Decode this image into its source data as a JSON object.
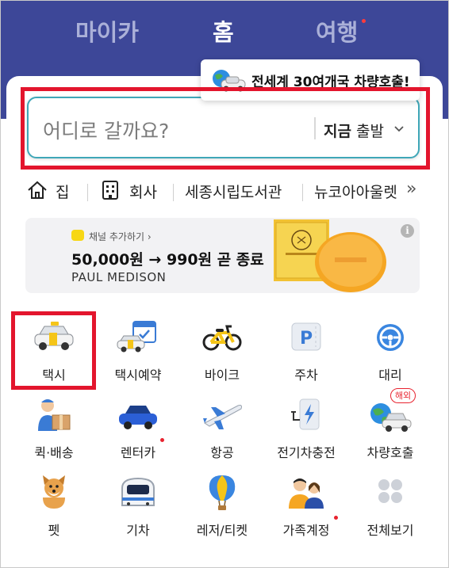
{
  "top_tabs": [
    {
      "label": "마이카",
      "active": false
    },
    {
      "label": "홈",
      "active": true
    },
    {
      "label": "여행",
      "active": false,
      "has_dot": true
    }
  ],
  "tooltip": {
    "text": "전세계 30여개국 차량호출!"
  },
  "search": {
    "placeholder": "어디로 갈까요?",
    "depart_now": "지금",
    "depart_label": "출발"
  },
  "places": [
    {
      "label": "집",
      "icon": "home-icon"
    },
    {
      "label": "회사",
      "icon": "building-icon"
    },
    {
      "label": "세종시립도서관"
    },
    {
      "label": "뉴코아아울렛"
    }
  ],
  "places_more": "»",
  "ad": {
    "subtitle": "채널 추가하기 ›",
    "title": "50,000원 → 990원 곧 종료",
    "brand": "PAUL MEDISON",
    "info_icon": "i"
  },
  "services": [
    {
      "label": "택시",
      "icon": "taxi-icon"
    },
    {
      "label": "택시예약",
      "icon": "taxi-reservation-icon"
    },
    {
      "label": "바이크",
      "icon": "bike-icon"
    },
    {
      "label": "주차",
      "icon": "parking-icon"
    },
    {
      "label": "대리",
      "icon": "driver-icon"
    },
    {
      "label": "퀵·배송",
      "icon": "delivery-icon"
    },
    {
      "label": "렌터카",
      "icon": "rental-car-icon",
      "dot": true
    },
    {
      "label": "항공",
      "icon": "airplane-icon"
    },
    {
      "label": "전기차충전",
      "icon": "ev-charge-icon"
    },
    {
      "label": "차량호출",
      "icon": "global-car-icon",
      "badge": "해외"
    },
    {
      "label": "펫",
      "icon": "pet-icon"
    },
    {
      "label": "기차",
      "icon": "train-icon"
    },
    {
      "label": "레저/티켓",
      "icon": "balloon-icon"
    },
    {
      "label": "가족계정",
      "icon": "family-icon",
      "dot": true
    },
    {
      "label": "전체보기",
      "icon": "grid-icon"
    }
  ],
  "colors": {
    "header": "#3d4798",
    "highlight": "#e3152d",
    "search_border": "#3fa7b8",
    "dot": "#e8232f"
  }
}
